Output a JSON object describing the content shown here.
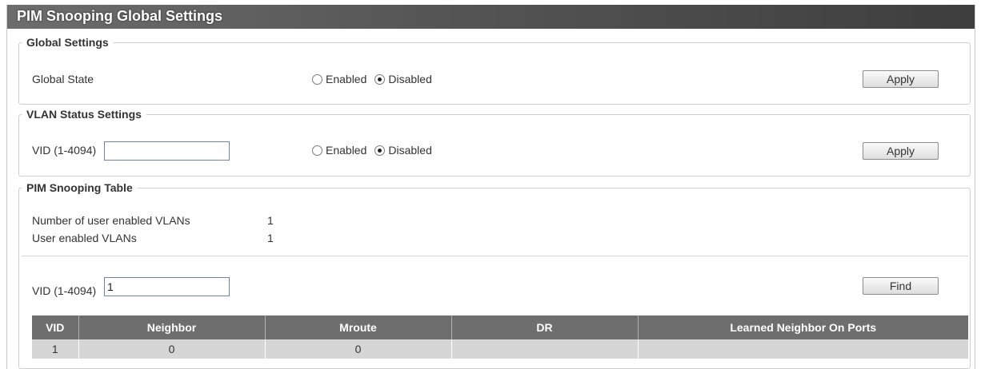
{
  "page": {
    "title": "PIM Snooping Global Settings"
  },
  "global_settings": {
    "legend": "Global Settings",
    "state_label": "Global State",
    "options": [
      "Enabled",
      "Disabled"
    ],
    "selected": "Disabled",
    "apply_label": "Apply"
  },
  "vlan_status": {
    "legend": "VLAN Status Settings",
    "vid_label": "VID (1-4094)",
    "vid_value": "",
    "options": [
      "Enabled",
      "Disabled"
    ],
    "selected": "Disabled",
    "apply_label": "Apply"
  },
  "pim_table": {
    "legend": "PIM Snooping Table",
    "num_enabled_label": "Number of user enabled VLANs",
    "num_enabled_value": "1",
    "enabled_vlans_label": "User enabled VLANs",
    "enabled_vlans_value": "1",
    "vid_label": "VID (1-4094)",
    "vid_value": "1",
    "find_label": "Find",
    "columns": [
      "VID",
      "Neighbor",
      "Mroute",
      "DR",
      "Learned Neighbor On Ports"
    ],
    "rows": [
      [
        "1",
        "0",
        "0",
        "",
        ""
      ]
    ]
  }
}
